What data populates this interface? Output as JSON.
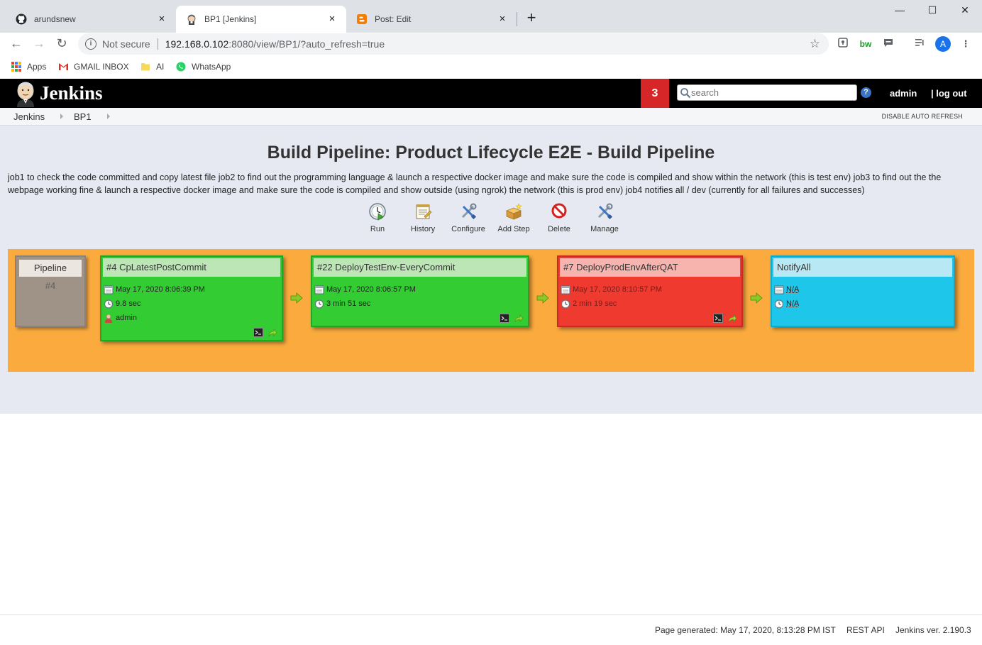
{
  "browser": {
    "tabs": [
      {
        "title": "arundsnew",
        "icon": "github-icon",
        "active": false
      },
      {
        "title": "BP1 [Jenkins]",
        "icon": "jenkins-icon",
        "active": true
      },
      {
        "title": "Post: Edit",
        "icon": "blogger-icon",
        "active": false
      }
    ],
    "close_glyph": "×",
    "new_tab_glyph": "+",
    "window_controls": {
      "minimize": "—",
      "maximize": "☐",
      "close": "✕"
    },
    "nav": {
      "back": "←",
      "forward": "→",
      "reload": "↻"
    },
    "omnibox": {
      "security": "Not secure",
      "url_host": "192.168.0.102",
      "url_rest": ":8080/view/BP1/?auto_refresh=true"
    },
    "bookmarks": [
      {
        "label": "Apps",
        "icon": "apps-grid-icon"
      },
      {
        "label": "GMAIL INBOX",
        "icon": "gmail-icon"
      },
      {
        "label": "AI",
        "icon": "folder-icon"
      },
      {
        "label": "WhatsApp",
        "icon": "whatsapp-icon"
      }
    ],
    "profile_initial": "A",
    "extensions": {
      "bw": "bw"
    }
  },
  "jenkins": {
    "title": "Jenkins",
    "notification_count": "3",
    "search_placeholder": "search",
    "help": "?",
    "user": "admin",
    "logout": "| log out",
    "breadcrumb": [
      "Jenkins",
      "BP1"
    ],
    "disable_auto_refresh": "DISABLE AUTO REFRESH"
  },
  "page": {
    "title": "Build Pipeline: Product Lifecycle E2E - Build Pipeline",
    "description": "job1 to check the code committed and copy latest file job2 to find out the programming language & launch a respective docker image and make sure the code is compiled and show within the network (this is test env) job3 to find out the the webpage working fine & launch a respective docker image and make sure the code is compiled and show outside (using ngrok) the network (this is prod env) job4 notifies all / dev (currently for all failures and successes)",
    "actions": [
      {
        "label": "Run",
        "icon": "run-clock-icon"
      },
      {
        "label": "History",
        "icon": "history-notepad-icon"
      },
      {
        "label": "Configure",
        "icon": "configure-tools-icon"
      },
      {
        "label": "Add Step",
        "icon": "add-step-box-icon"
      },
      {
        "label": "Delete",
        "icon": "delete-no-entry-icon"
      },
      {
        "label": "Manage",
        "icon": "manage-tools-icon"
      }
    ]
  },
  "pipeline": {
    "label": "Pipeline",
    "number": "#4",
    "jobs": [
      {
        "title": "#4 CpLatestPostCommit",
        "date": "May 17, 2020 8:06:39 PM",
        "duration": "9.8 sec",
        "user": "admin",
        "status": "success",
        "color": "#33cc33"
      },
      {
        "title": "#22 DeployTestEnv-EveryCommit",
        "date": "May 17, 2020 8:06:57 PM",
        "duration": "3 min 51 sec",
        "status": "success",
        "color": "#33cc33"
      },
      {
        "title": "#7 DeployProdEnvAfterQAT",
        "date": "May 17, 2020 8:10:57 PM",
        "duration": "2 min 19 sec",
        "status": "failure",
        "color": "#ef3a30"
      },
      {
        "title": "NotifyAll",
        "date": "N/A",
        "duration": "N/A",
        "status": "pending",
        "color": "#1ec6ea"
      }
    ],
    "background_color": "#fbab3e"
  },
  "footer": {
    "generated": "Page generated: May 17, 2020, 8:13:28 PM IST",
    "rest_api": "REST API",
    "version": "Jenkins ver. 2.190.3"
  }
}
